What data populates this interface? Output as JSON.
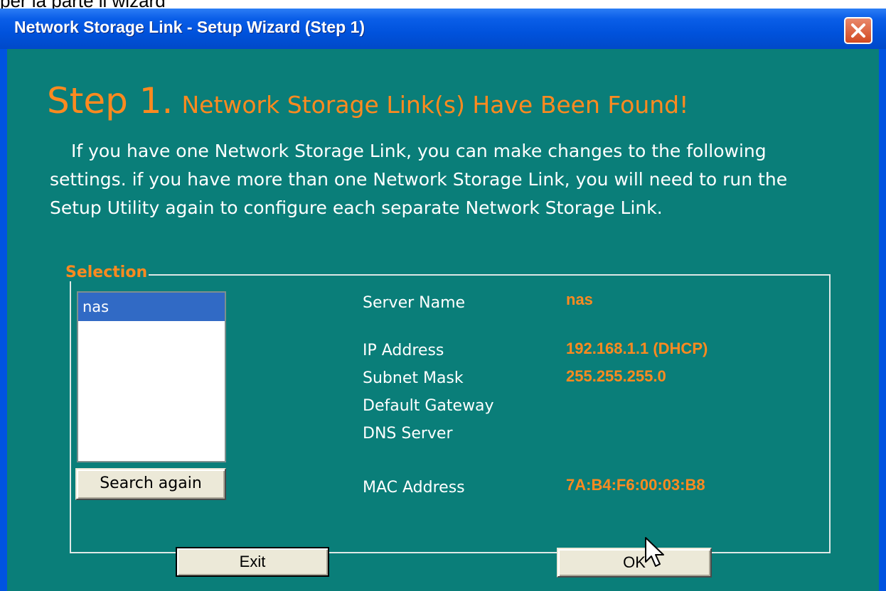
{
  "caption": "per la parte il wizard",
  "window": {
    "title": "Network Storage Link - Setup Wizard (Step 1)"
  },
  "heading": {
    "step": "Step 1.",
    "title": "Network Storage Link(s) Have Been Found!"
  },
  "intro": "If you have one Network Storage Link, you can make changes to the following settings. if you have more than one Network Storage Link, you will need to run the Setup Utility again to configure each separate Network Storage Link.",
  "selection": {
    "label": "Selection",
    "items": [
      "nas"
    ],
    "selected": "nas",
    "search_label": "Search again"
  },
  "details": {
    "server_name_label": "Server Name",
    "server_name": "nas",
    "ip_label": "IP Address",
    "ip": "192.168.1.1 (DHCP)",
    "subnet_label": "Subnet Mask",
    "subnet": "255.255.255.0",
    "gateway_label": "Default Gateway",
    "gateway": "",
    "dns_label": "DNS Server",
    "dns": "",
    "mac_label": "MAC Address",
    "mac": "7A:B4:F6:00:03:B8"
  },
  "buttons": {
    "exit": "Exit",
    "ok": "OK"
  },
  "colors": {
    "client_bg": "#0a7e79",
    "accent": "#ff8a1f",
    "title_bar": "#0052dc"
  },
  "icons": {
    "close": "close-icon",
    "cursor": "mouse-cursor-icon"
  }
}
